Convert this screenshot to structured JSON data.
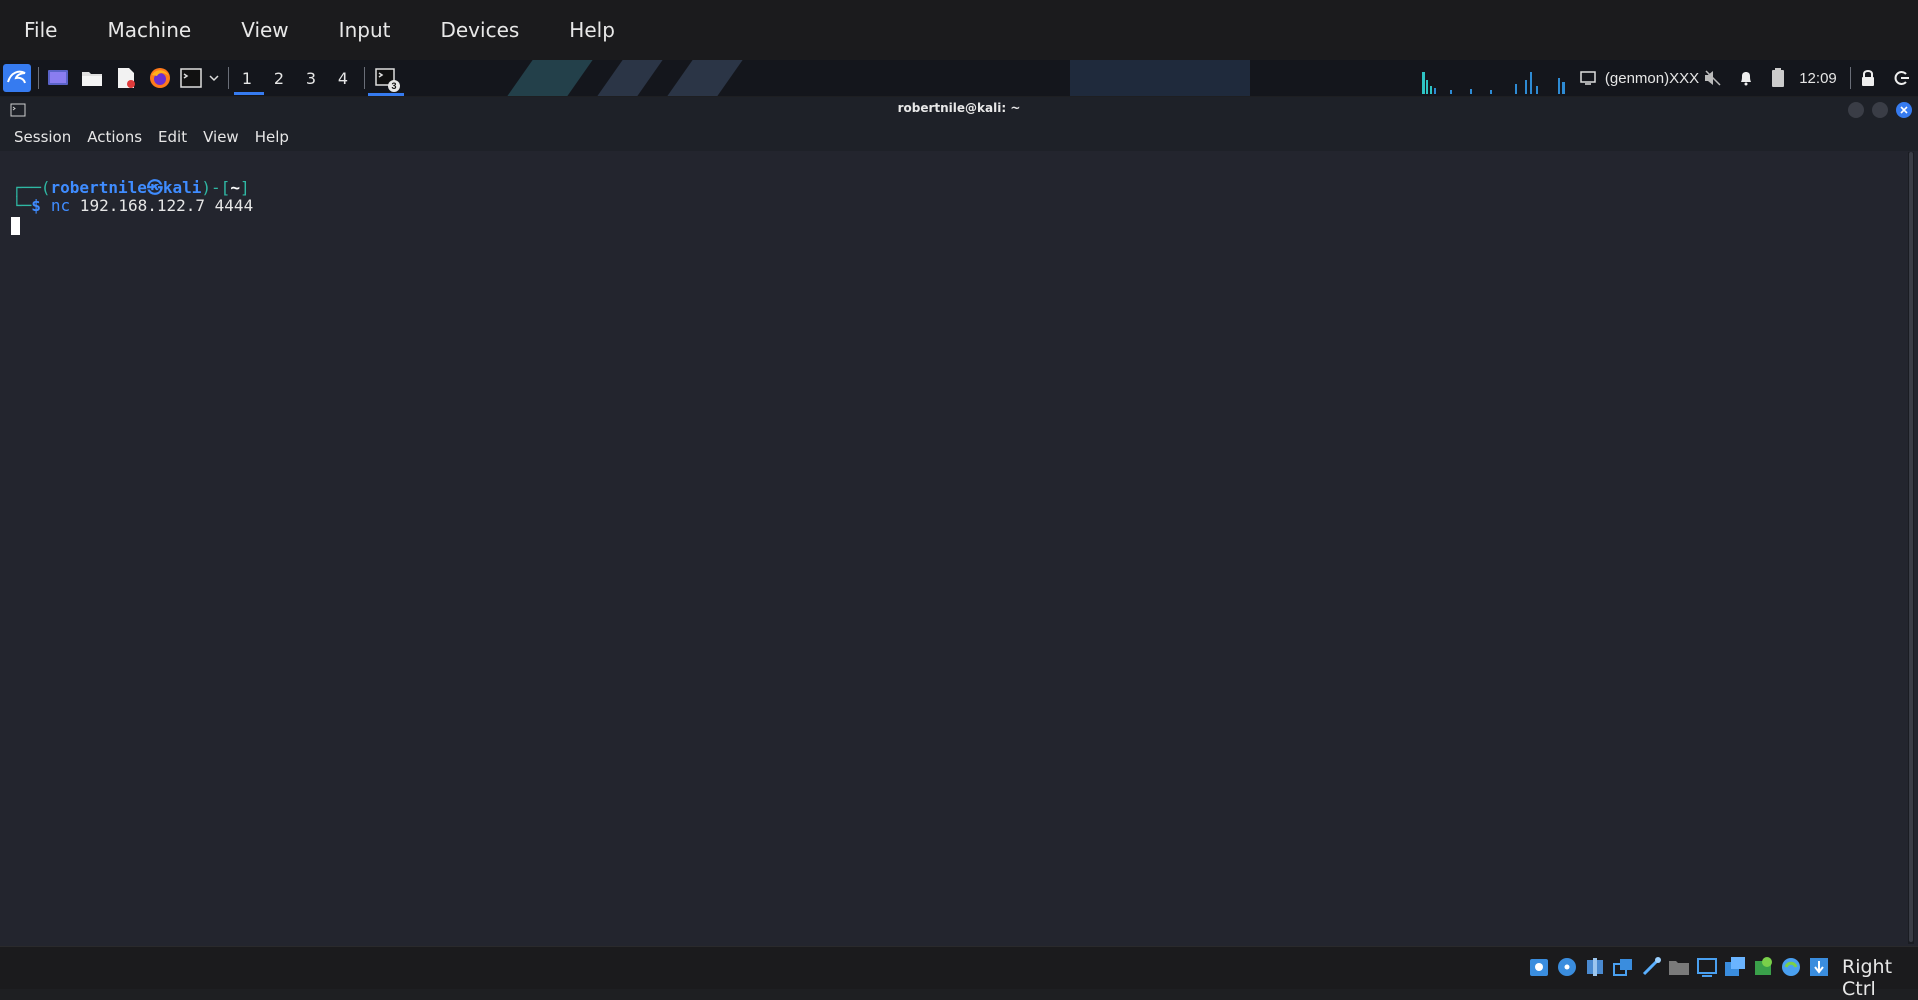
{
  "vbox_menu": {
    "items": [
      "File",
      "Machine",
      "View",
      "Input",
      "Devices",
      "Help"
    ]
  },
  "panel": {
    "workspaces": [
      "1",
      "2",
      "3",
      "4"
    ],
    "active_workspace": "1",
    "task_badge": "3",
    "genmon": "(genmon)XXX",
    "clock": "12:09"
  },
  "terminal": {
    "title": "robertnile@kali: ~",
    "menu": [
      "Session",
      "Actions",
      "Edit",
      "View",
      "Help"
    ],
    "prompt": {
      "corner_top": "┌──(",
      "user": "robertnile",
      "at_symbol": "㉿",
      "host": "kali",
      "mid": ")-[",
      "path": "~",
      "end": "]",
      "corner_bottom": "└─",
      "dollar": "$",
      "command": "nc",
      "args": " 192.168.122.7 4444"
    }
  },
  "status_bar": {
    "host_key": "Right Ctrl"
  },
  "colors": {
    "accent_blue": "#367bf0",
    "prompt_green": "#2fb8a4",
    "user_blue": "#3f8cff"
  }
}
